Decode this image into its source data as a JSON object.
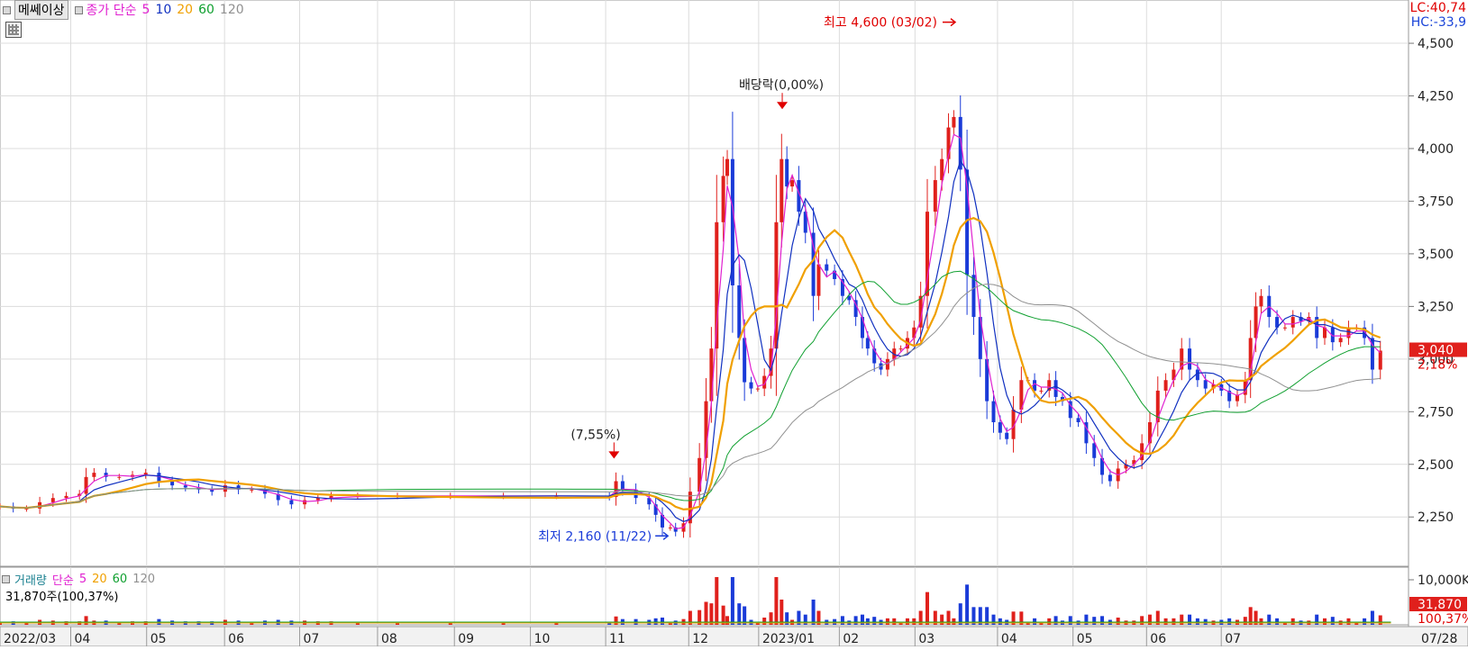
{
  "header": {
    "chart_label": "메쎄이상",
    "ma_label": "종가 단순",
    "ma_periods": [
      {
        "label": "5",
        "color": "#e020d0"
      },
      {
        "label": "10",
        "color": "#1030c0"
      },
      {
        "label": "20",
        "color": "#f0a000"
      },
      {
        "label": "60",
        "color": "#10a030"
      },
      {
        "label": "120",
        "color": "#909090"
      }
    ],
    "lc": "LC:40,74",
    "hc": "HC:-33,9"
  },
  "volume_header": {
    "label": "거래량",
    "ma_label": "단순",
    "ma_periods": [
      {
        "label": "5",
        "color": "#e020d0"
      },
      {
        "label": "20",
        "color": "#f0a000"
      },
      {
        "label": "60",
        "color": "#10a030"
      },
      {
        "label": "120",
        "color": "#909090"
      }
    ],
    "info": "31,870주(100,37%)"
  },
  "colors": {
    "up": "#e0201c",
    "down": "#1a3bd8",
    "grid": "#dcdcdc",
    "axis_bg": "#ffffff"
  },
  "chart_data": [
    {
      "type": "candlestick",
      "y_ticks": [
        "2,250",
        "2,500",
        "2,750",
        "3,000",
        "3,250",
        "3,500",
        "3,750",
        "4,000",
        "4,250",
        "4,500"
      ],
      "y_tick_values": [
        2250,
        2500,
        2750,
        3000,
        3250,
        3500,
        3750,
        4000,
        4250,
        4500
      ],
      "ylim": [
        2050,
        4620
      ],
      "x_labels": [
        "2022/03",
        "04",
        "05",
        "06",
        "07",
        "08",
        "09",
        "10",
        "11",
        "12",
        "2023/01",
        "02",
        "03",
        "04",
        "05",
        "06",
        "07"
      ],
      "x_end_label": "07/28",
      "x_range": [
        0,
        1
      ],
      "x_label_positions": [
        0.0,
        0.0534,
        0.1107,
        0.1695,
        0.2262,
        0.285,
        0.343,
        0.4004,
        0.4572,
        0.5199,
        0.5727,
        0.6336,
        0.6907,
        0.753,
        0.81,
        0.8655,
        0.9219
      ],
      "close_series": [
        [
          0.0,
          2300
        ],
        [
          0.01,
          2290
        ],
        [
          0.02,
          2290
        ],
        [
          0.03,
          2320
        ],
        [
          0.04,
          2340
        ],
        [
          0.05,
          2350
        ],
        [
          0.06,
          2360
        ],
        [
          0.065,
          2440
        ],
        [
          0.071,
          2460
        ],
        [
          0.08,
          2440
        ],
        [
          0.09,
          2440
        ],
        [
          0.1,
          2450
        ],
        [
          0.11,
          2460
        ],
        [
          0.12,
          2420
        ],
        [
          0.13,
          2400
        ],
        [
          0.14,
          2390
        ],
        [
          0.15,
          2380
        ],
        [
          0.16,
          2370
        ],
        [
          0.17,
          2400
        ],
        [
          0.18,
          2380
        ],
        [
          0.19,
          2380
        ],
        [
          0.2,
          2360
        ],
        [
          0.21,
          2330
        ],
        [
          0.22,
          2310
        ],
        [
          0.23,
          2330
        ],
        [
          0.24,
          2340
        ],
        [
          0.25,
          2350
        ],
        [
          0.27,
          2350
        ],
        [
          0.3,
          2350
        ],
        [
          0.34,
          2350
        ],
        [
          0.38,
          2350
        ],
        [
          0.42,
          2350
        ],
        [
          0.46,
          2345
        ],
        [
          0.465,
          2420
        ],
        [
          0.47,
          2380
        ],
        [
          0.48,
          2340
        ],
        [
          0.49,
          2310
        ],
        [
          0.495,
          2260
        ],
        [
          0.5,
          2200
        ],
        [
          0.506,
          2200
        ],
        [
          0.51,
          2180
        ],
        [
          0.516,
          2220
        ],
        [
          0.521,
          2370
        ],
        [
          0.528,
          2530
        ],
        [
          0.533,
          2800
        ],
        [
          0.537,
          3050
        ],
        [
          0.541,
          3650
        ],
        [
          0.546,
          3870
        ],
        [
          0.549,
          3950
        ],
        [
          0.553,
          3350
        ],
        [
          0.558,
          3100
        ],
        [
          0.562,
          2890
        ],
        [
          0.567,
          2860
        ],
        [
          0.572,
          2860
        ],
        [
          0.577,
          2920
        ],
        [
          0.582,
          3050
        ],
        [
          0.586,
          3650
        ],
        [
          0.59,
          3950
        ],
        [
          0.594,
          3820
        ],
        [
          0.598,
          3850
        ],
        [
          0.603,
          3700
        ],
        [
          0.608,
          3600
        ],
        [
          0.614,
          3300
        ],
        [
          0.618,
          3450
        ],
        [
          0.624,
          3420
        ],
        [
          0.63,
          3380
        ],
        [
          0.636,
          3300
        ],
        [
          0.641,
          3280
        ],
        [
          0.646,
          3200
        ],
        [
          0.651,
          3100
        ],
        [
          0.655,
          3050
        ],
        [
          0.66,
          2980
        ],
        [
          0.665,
          2950
        ],
        [
          0.67,
          3000
        ],
        [
          0.675,
          3050
        ],
        [
          0.68,
          3050
        ],
        [
          0.685,
          3100
        ],
        [
          0.69,
          3150
        ],
        [
          0.695,
          3300
        ],
        [
          0.7,
          3700
        ],
        [
          0.706,
          3850
        ],
        [
          0.711,
          3950
        ],
        [
          0.716,
          4100
        ],
        [
          0.72,
          4150
        ],
        [
          0.725,
          3900
        ],
        [
          0.73,
          3400
        ],
        [
          0.735,
          3200
        ],
        [
          0.74,
          3000
        ],
        [
          0.745,
          2800
        ],
        [
          0.75,
          2700
        ],
        [
          0.755,
          2650
        ],
        [
          0.76,
          2620
        ],
        [
          0.765,
          2760
        ],
        [
          0.771,
          2900
        ],
        [
          0.776,
          2900
        ],
        [
          0.781,
          2850
        ],
        [
          0.786,
          2850
        ],
        [
          0.792,
          2900
        ],
        [
          0.797,
          2820
        ],
        [
          0.802,
          2800
        ],
        [
          0.808,
          2720
        ],
        [
          0.814,
          2700
        ],
        [
          0.82,
          2600
        ],
        [
          0.826,
          2530
        ],
        [
          0.832,
          2450
        ],
        [
          0.838,
          2420
        ],
        [
          0.844,
          2480
        ],
        [
          0.85,
          2500
        ],
        [
          0.856,
          2520
        ],
        [
          0.862,
          2600
        ],
        [
          0.868,
          2700
        ],
        [
          0.874,
          2850
        ],
        [
          0.88,
          2900
        ],
        [
          0.886,
          2950
        ],
        [
          0.892,
          3050
        ],
        [
          0.898,
          2950
        ],
        [
          0.904,
          2900
        ],
        [
          0.91,
          2860
        ],
        [
          0.916,
          2880
        ],
        [
          0.922,
          2850
        ],
        [
          0.928,
          2800
        ],
        [
          0.934,
          2830
        ],
        [
          0.94,
          2900
        ],
        [
          0.944,
          3100
        ],
        [
          0.948,
          3250
        ],
        [
          0.952,
          3300
        ],
        [
          0.958,
          3200
        ],
        [
          0.964,
          3150
        ],
        [
          0.97,
          3150
        ],
        [
          0.976,
          3200
        ],
        [
          0.982,
          3180
        ],
        [
          0.988,
          3200
        ],
        [
          0.994,
          3100
        ],
        [
          1.0,
          3150
        ],
        [
          1.006,
          3080
        ],
        [
          1.012,
          3100
        ],
        [
          1.018,
          3150
        ],
        [
          1.024,
          3150
        ],
        [
          1.03,
          3100
        ],
        [
          1.036,
          2950
        ],
        [
          1.042,
          3040
        ]
      ],
      "annotations": [
        {
          "text": "최고 4,600 (03/02)",
          "x": 0.7238,
          "y": 4600,
          "color": "#e00000",
          "kind": "high"
        },
        {
          "text": "최저 2,160 (11/22)",
          "x": 0.5069,
          "y": 2160,
          "color": "#1a3bd8",
          "kind": "low"
        },
        {
          "text": "배당락(0,00%)",
          "x": 0.5905,
          "y": 4170,
          "color": "#222222",
          "kind": "event"
        },
        {
          "text": "(7,55%)",
          "x": 0.4635,
          "y": 2510,
          "color": "#222222",
          "kind": "event"
        }
      ],
      "last_price_label": "3,040",
      "last_price_value": 3040,
      "last_change_label": "2,18%"
    },
    {
      "type": "bar",
      "title": "거래량",
      "y_ticks": [
        "10,000K"
      ],
      "last_volume_label": "31,870",
      "last_volume_pct_label": "100,37%"
    }
  ]
}
